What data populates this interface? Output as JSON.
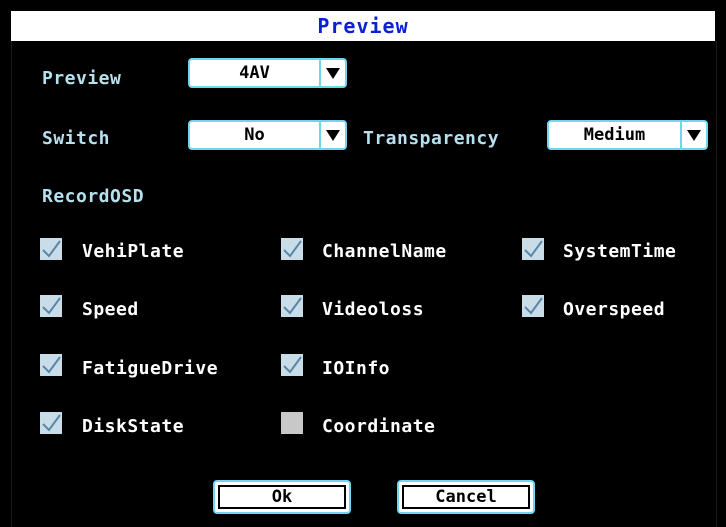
{
  "window": {
    "title": "Preview"
  },
  "preview": {
    "label": "Preview",
    "value": "4AV"
  },
  "switch": {
    "label": "Switch",
    "value": "No"
  },
  "transparency": {
    "label": "Transparency",
    "value": "Medium"
  },
  "record_osd": {
    "label": "RecordOSD",
    "items": [
      {
        "label": "VehiPlate",
        "checked": true
      },
      {
        "label": "ChannelName",
        "checked": true
      },
      {
        "label": "SystemTime",
        "checked": true
      },
      {
        "label": "Speed",
        "checked": true
      },
      {
        "label": "Videoloss",
        "checked": true
      },
      {
        "label": "Overspeed",
        "checked": true
      },
      {
        "label": "FatigueDrive",
        "checked": true
      },
      {
        "label": "IOInfo",
        "checked": true
      },
      {
        "label": "DiskState",
        "checked": true
      },
      {
        "label": "Coordinate",
        "checked": false
      }
    ]
  },
  "buttons": {
    "ok": "Ok",
    "cancel": "Cancel"
  },
  "colors": {
    "title_text": "#0a21d6",
    "label_text": "#b6e0ee",
    "border_accent": "#6fd6ee",
    "checkbox": "#c9dde8",
    "background": "#000000"
  }
}
